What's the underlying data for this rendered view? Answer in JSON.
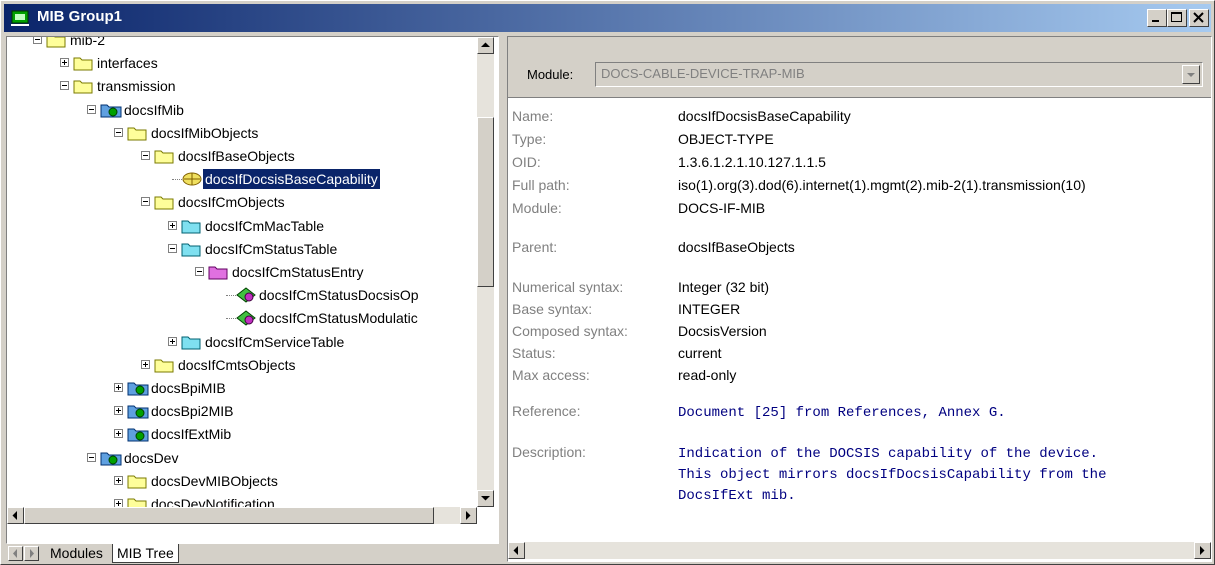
{
  "window": {
    "title": "MIB Group1"
  },
  "tree": [
    {
      "label": "mib-2",
      "depth": 0,
      "expander": "minus",
      "icon": "folder-icon"
    },
    {
      "label": "interfaces",
      "depth": 1,
      "expander": "plus",
      "icon": "folder-icon"
    },
    {
      "label": "transmission",
      "depth": 1,
      "expander": "minus",
      "icon": "folder-icon"
    },
    {
      "label": "docsIfMib",
      "depth": 2,
      "expander": "minus",
      "icon": "module-folder-icon"
    },
    {
      "label": "docsIfMibObjects",
      "depth": 3,
      "expander": "minus",
      "icon": "folder-icon"
    },
    {
      "label": "docsIfBaseObjects",
      "depth": 4,
      "expander": "minus",
      "icon": "folder-icon"
    },
    {
      "label": "docsIfDocsisBaseCapability",
      "depth": 5,
      "expander": "none",
      "icon": "scalar-leaf-icon",
      "selected": true
    },
    {
      "label": "docsIfCmObjects",
      "depth": 4,
      "expander": "minus",
      "icon": "folder-icon"
    },
    {
      "label": "docsIfCmMacTable",
      "depth": 5,
      "expander": "plus",
      "icon": "table-folder-icon"
    },
    {
      "label": "docsIfCmStatusTable",
      "depth": 5,
      "expander": "minus",
      "icon": "table-folder-icon"
    },
    {
      "label": "docsIfCmStatusEntry",
      "depth": 6,
      "expander": "minus",
      "icon": "entry-folder-icon"
    },
    {
      "label": "docsIfCmStatusDocsisOp",
      "depth": 7,
      "expander": "none",
      "icon": "column-leaf-icon"
    },
    {
      "label": "docsIfCmStatusModulatic",
      "depth": 7,
      "expander": "none",
      "icon": "column-leaf-icon"
    },
    {
      "label": "docsIfCmServiceTable",
      "depth": 5,
      "expander": "plus",
      "icon": "table-folder-icon"
    },
    {
      "label": "docsIfCmtsObjects",
      "depth": 4,
      "expander": "plus",
      "icon": "folder-icon"
    },
    {
      "label": "docsBpiMIB",
      "depth": 3,
      "expander": "plus",
      "icon": "module-folder-icon"
    },
    {
      "label": "docsBpi2MIB",
      "depth": 3,
      "expander": "plus",
      "icon": "module-folder-icon"
    },
    {
      "label": "docsIfExtMib",
      "depth": 3,
      "expander": "plus",
      "icon": "module-folder-icon"
    },
    {
      "label": "docsDev",
      "depth": 2,
      "expander": "minus",
      "icon": "module-folder-icon"
    },
    {
      "label": "docsDevMIBObjects",
      "depth": 3,
      "expander": "plus",
      "icon": "folder-icon"
    },
    {
      "label": "docsDevNotification",
      "depth": 3,
      "expander": "plus",
      "icon": "folder-icon"
    }
  ],
  "tabs": {
    "modules": "Modules",
    "mib_tree": "MIB Tree",
    "active": "MIB Tree"
  },
  "details": {
    "module_label": "Module:",
    "module_value": "DOCS-CABLE-DEVICE-TRAP-MIB",
    "fields": [
      {
        "label": "Name:",
        "value": "docsIfDocsisBaseCapability"
      },
      {
        "label": "Type:",
        "value": "OBJECT-TYPE"
      },
      {
        "label": "OID:",
        "value": "1.3.6.1.2.1.10.127.1.1.5"
      },
      {
        "label": "Full path:",
        "value": "iso(1).org(3).dod(6).internet(1).mgmt(2).mib-2(1).transmission(10)"
      },
      {
        "label": "Module:",
        "value": "DOCS-IF-MIB"
      },
      {
        "label": "Parent:",
        "value": "docsIfBaseObjects"
      },
      {
        "label": "Numerical syntax:",
        "value": "Integer (32 bit)"
      },
      {
        "label": "Base syntax:",
        "value": "INTEGER"
      },
      {
        "label": "Composed syntax:",
        "value": "DocsisVersion"
      },
      {
        "label": "Status:",
        "value": "current"
      },
      {
        "label": "Max access:",
        "value": "read-only"
      }
    ],
    "reference_label": "Reference:",
    "reference": "Document [25] from References, Annex G.",
    "description_label": "Description:",
    "description": "Indication of the DOCSIS capability of the device.\nThis object mirrors docsIfDocsisCapability from the\nDocsIfExt mib."
  },
  "colors": {
    "title_start": "#0a246a",
    "title_end": "#a6caf0",
    "selection": "#0a246a",
    "mono_text": "#000080"
  }
}
